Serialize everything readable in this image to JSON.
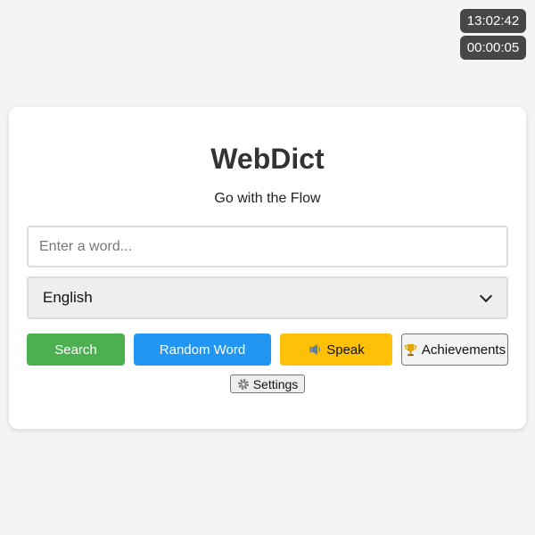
{
  "clock": {
    "time": "13:02:42",
    "timer": "00:00:05"
  },
  "app": {
    "title": "WebDict",
    "tagline": "Go with the Flow"
  },
  "search": {
    "placeholder": "Enter a word..."
  },
  "language": {
    "selected": "English"
  },
  "buttons": {
    "search": "Search",
    "random": "Random Word",
    "speak": "Speak",
    "achievements": "Achievements",
    "settings": "Settings"
  },
  "icons": {
    "speak": "speaker-icon",
    "achievements": "trophy-icon",
    "settings": "gear-icon",
    "language": "chevron-down-icon"
  },
  "colors": {
    "search_button": "#4caf50",
    "random_button": "#2196f3",
    "speak_button": "#ffc107",
    "clock_bg": "#474747"
  }
}
